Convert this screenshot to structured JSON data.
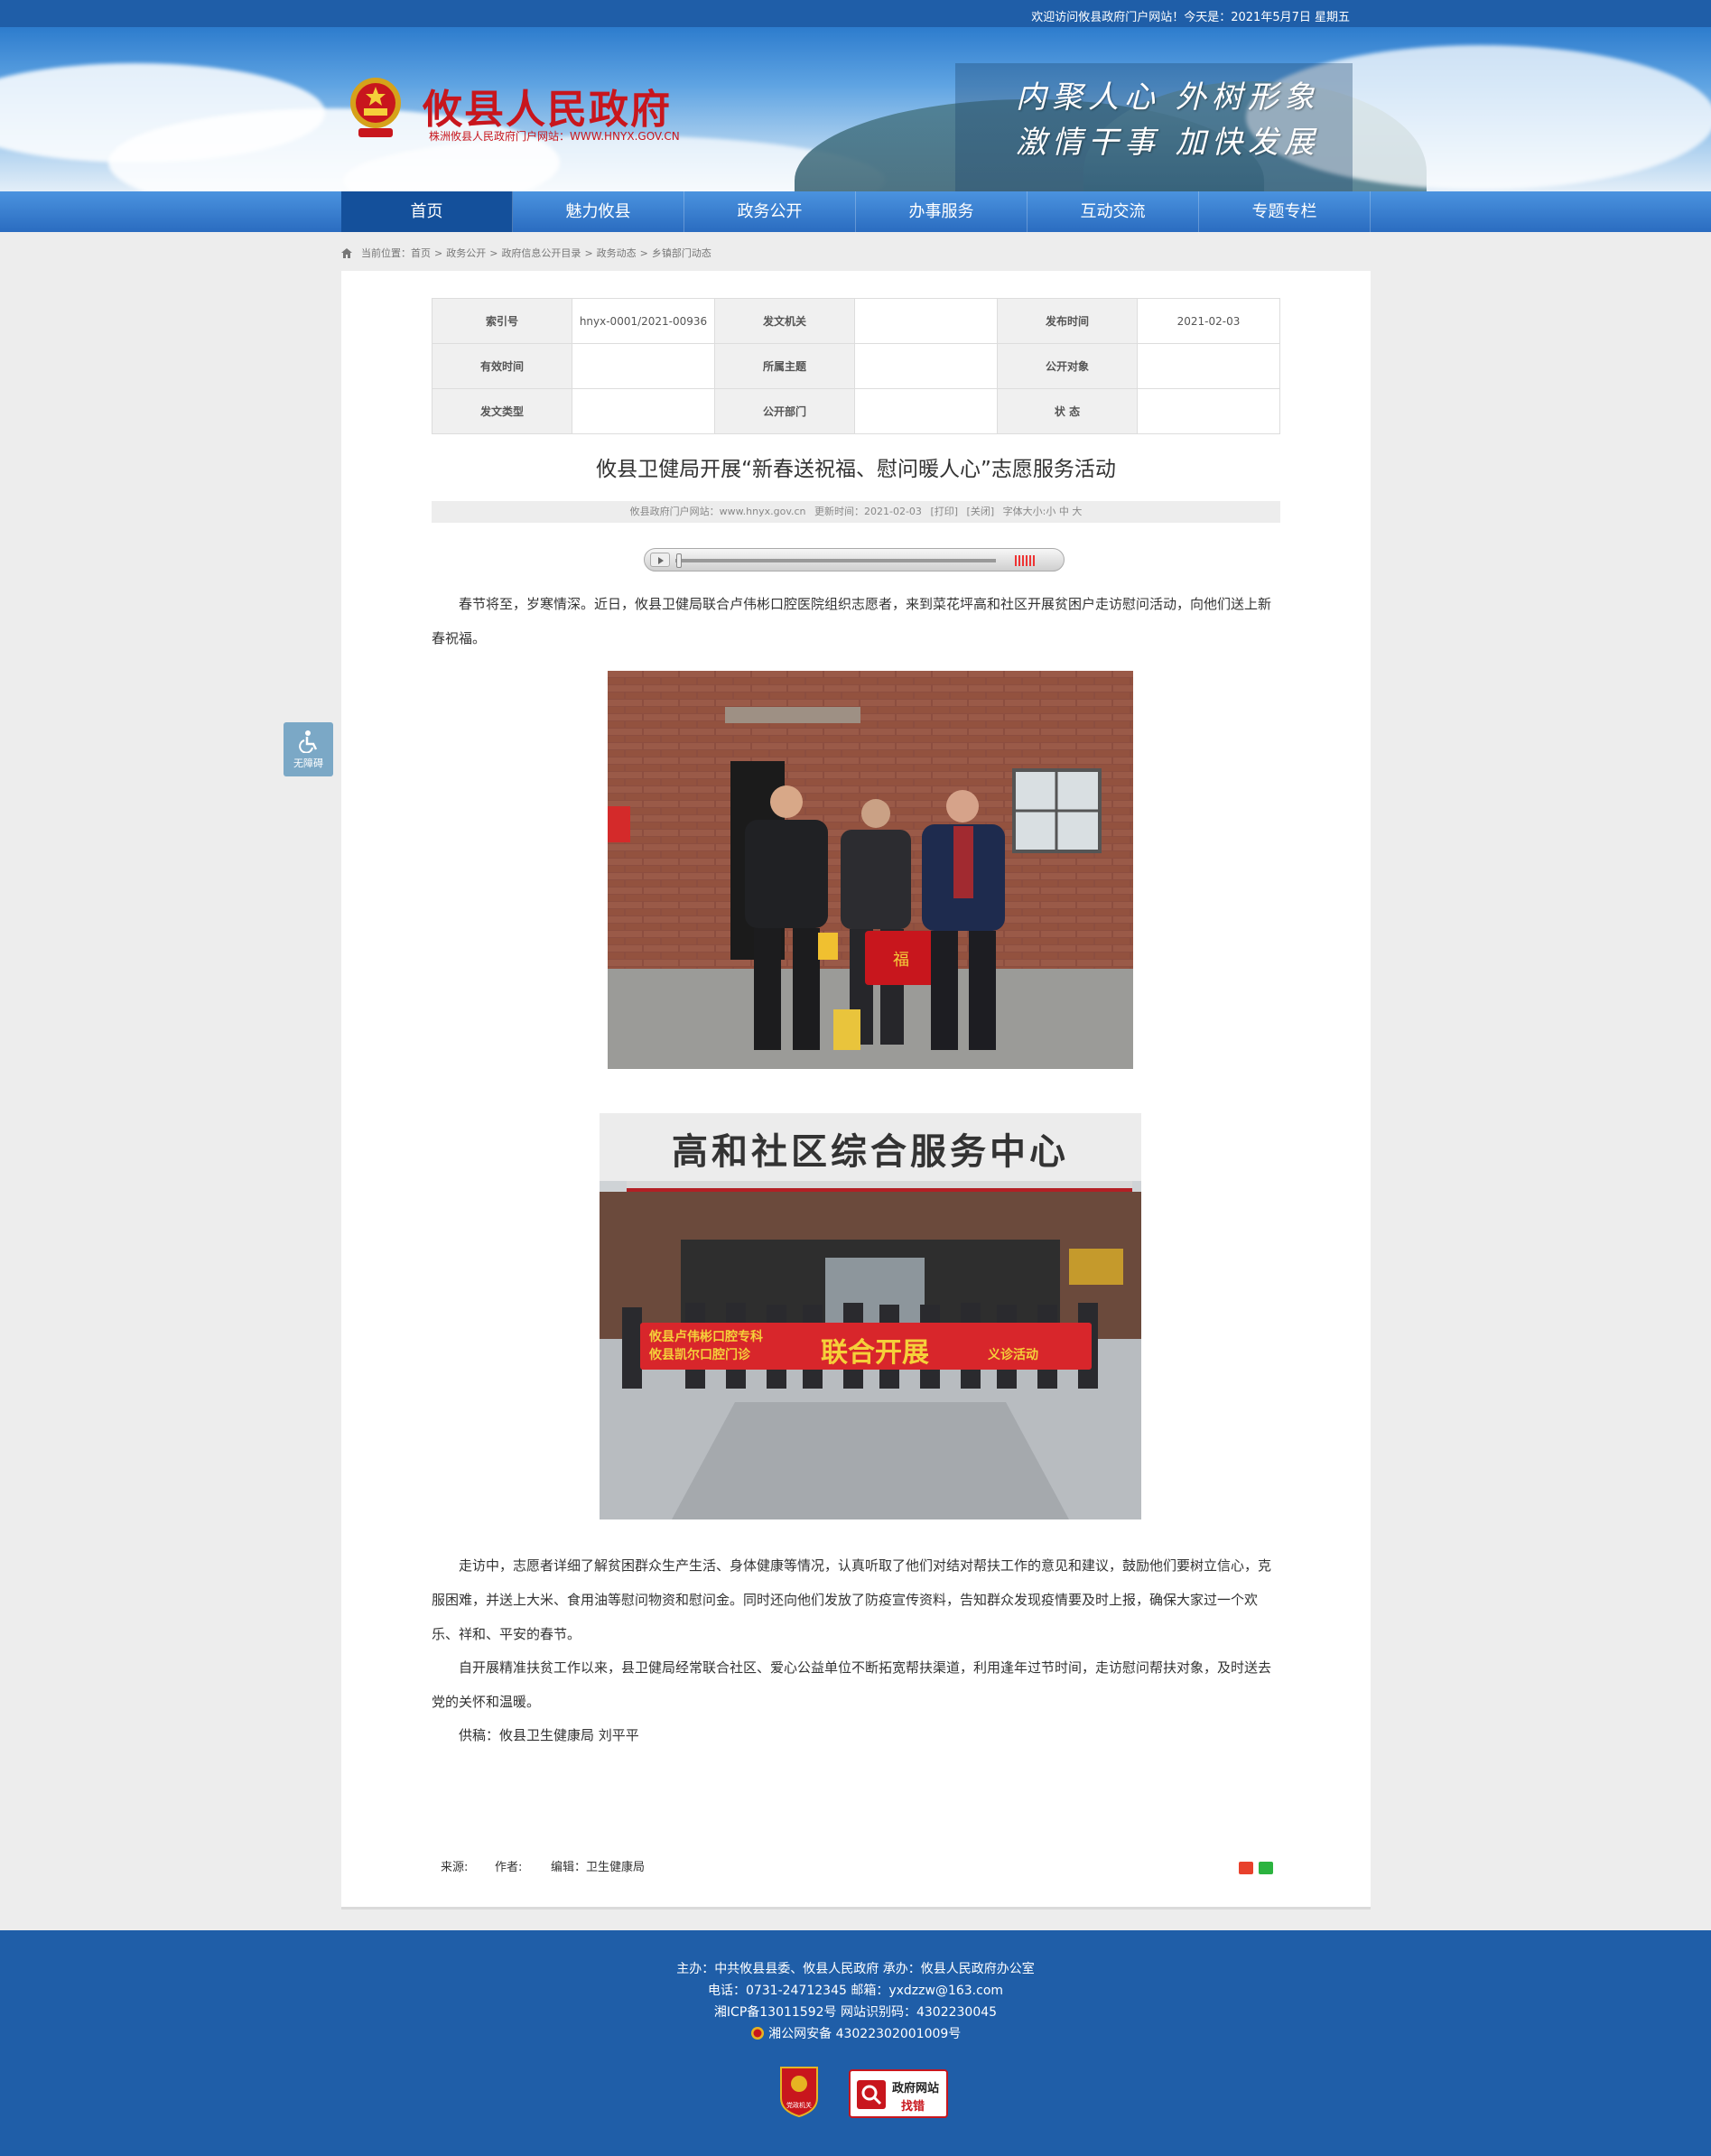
{
  "topbar": {
    "welcome": "欢迎访问攸县政府门户网站！今天是：2021年5月7日 星期五"
  },
  "header": {
    "site_name": "攸县人民政府",
    "site_sub": "株洲攸县人民政府门户网站：WWW.HNYX.GOV.CN",
    "slogan_line1": "内聚人心 外树形象",
    "slogan_line2": "激情干事 加快发展"
  },
  "nav": [
    "首页",
    "魅力攸县",
    "政务公开",
    "办事服务",
    "互动交流",
    "专题专栏"
  ],
  "breadcrumb": {
    "prefix": "当前位置：",
    "items": [
      "首页",
      "政务公开",
      "政府信息公开目录",
      "政务动态",
      "乡镇部门动态"
    ]
  },
  "a11y_label": "无障碍",
  "meta_table": {
    "r1": {
      "k1": "索引号",
      "v1": "hnyx-0001/2021-00936",
      "k2": "发文机关",
      "v2": "",
      "k3": "发布时间",
      "v3": "2021-02-03"
    },
    "r2": {
      "k1": "有效时间",
      "v1": "",
      "k2": "所属主题",
      "v2": "",
      "k3": "公开对象",
      "v3": ""
    },
    "r3": {
      "k1": "发文类型",
      "v1": "",
      "k2": "公开部门",
      "v2": "",
      "k3": "状 态",
      "v3": ""
    }
  },
  "article": {
    "title": "攸县卫健局开展“新春送祝福、慰问暖人心”志愿服务活动",
    "info_site": "攸县政府门户网站：www.hnyx.gov.cn",
    "info_update": "更新时间：2021-02-03",
    "info_print": "[打印]",
    "info_close": "[关闭]",
    "info_font": "字体大小:小 中 大",
    "p1": "春节将至，岁寒情深。近日，攸县卫健局联合卢伟彬口腔医院组织志愿者，来到菜花坪高和社区开展贫困户走访慰问活动，向他们送上新春祝福。",
    "photo2_sign": "高和社区综合服务中心",
    "photo2_banner_a": "攸县卢伟彬口腔专科",
    "photo2_banner_b": "攸县凯尔口腔门诊",
    "photo2_banner_c": "联合开展",
    "photo2_banner_d": "义诊活动",
    "p2": "走访中，志愿者详细了解贫困群众生产生活、身体健康等情况，认真听取了他们对结对帮扶工作的意见和建议，鼓励他们要树立信心，克服困难，并送上大米、食用油等慰问物资和慰问金。同时还向他们发放了防疫宣传资料，告知群众发现疫情要及时上报，确保大家过一个欢乐、祥和、平安的春节。",
    "p3": "自开展精准扶贫工作以来，县卫健局经常联合社区、爱心公益单位不断拓宽帮扶渠道，利用逢年过节时间，走访慰问帮扶对象，及时送去党的关怀和温暖。",
    "p4": "供稿：攸县卫生健康局   刘平平",
    "source": "来源:",
    "author": "作者:",
    "editor": "编辑：卫生健康局"
  },
  "footer": {
    "l1": "主办：中共攸县县委、攸县人民政府 承办：攸县人民政府办公室",
    "l2": "电话：0731-24712345 邮箱：yxdzzw@163.com",
    "l3": "湘ICP备13011592号   网站识别码：4302230045",
    "l4": "湘公网安备 43022302001009号",
    "badge1": "党政机关",
    "badge2_a": "政府网站",
    "badge2_b": "找错"
  },
  "colors": {
    "brand_blue": "#1f5ea8",
    "brand_red": "#c8161d",
    "nav_active": "#14509b"
  }
}
